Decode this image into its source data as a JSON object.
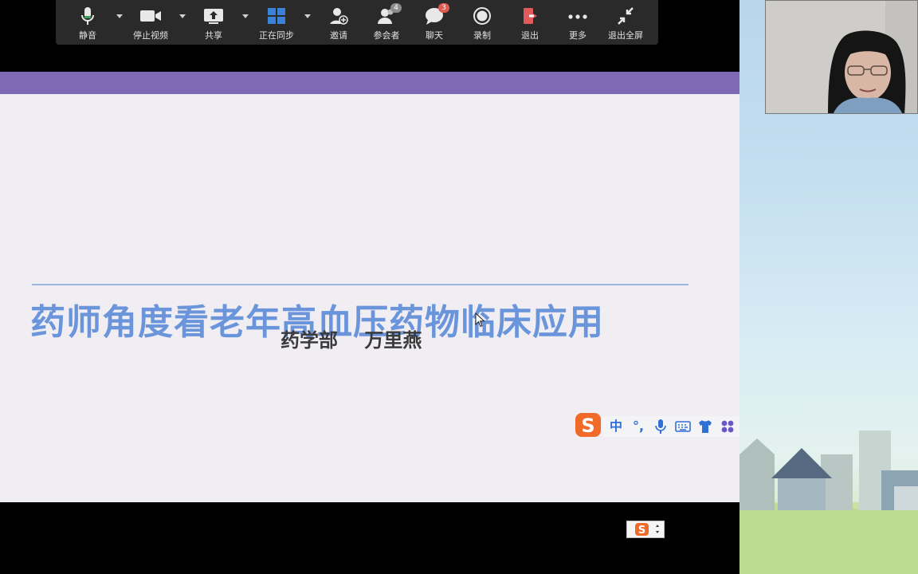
{
  "toolbar": {
    "items": [
      {
        "label": "静音",
        "icon": "microphone-icon"
      },
      {
        "label": "停止视频",
        "icon": "video-camera-icon"
      },
      {
        "label": "共享",
        "icon": "share-screen-icon"
      },
      {
        "label": "正在同步",
        "icon": "sync-grid-icon"
      },
      {
        "label": "邀请",
        "icon": "add-user-icon"
      },
      {
        "label": "参会者",
        "icon": "participants-icon",
        "badge": "4"
      },
      {
        "label": "聊天",
        "icon": "chat-icon",
        "badge": "3"
      },
      {
        "label": "录制",
        "icon": "record-icon"
      },
      {
        "label": "退出",
        "icon": "exit-icon"
      },
      {
        "label": "更多",
        "icon": "more-icon"
      },
      {
        "label": "退出全屏",
        "icon": "exit-fullscreen-icon"
      }
    ]
  },
  "slide": {
    "title": "药师角度看老年高血压药物临床应用",
    "author": "药学部    万里燕"
  },
  "ime": {
    "logo": "S",
    "buttons": [
      "中",
      "°,",
      "mic",
      "keyboard",
      "shirt",
      "apps"
    ]
  },
  "ime_small": {
    "logo": "S"
  },
  "colors": {
    "slide_bar": "#7f69b5",
    "title": "#6b95db",
    "toolbar": "#2a2a2a",
    "badge": "#e05a4f",
    "badge_gray": "#8c8c8c",
    "exit_red": "#e25b5b",
    "sync_blue": "#3b82d6"
  }
}
